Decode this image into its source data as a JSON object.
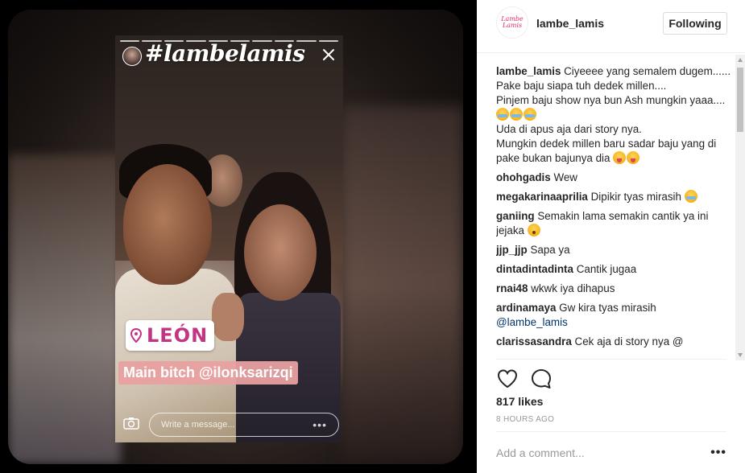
{
  "story": {
    "title": "#lambelamis",
    "location": "LEÓN",
    "mention": "Main bitch @ilonksarizqi",
    "message_placeholder": "Write a message...",
    "message_more": "•••"
  },
  "header": {
    "username": "lambe_lamis",
    "follow_label": "Following",
    "avatar_logo": "Lambe Lamis"
  },
  "caption": {
    "user": "lambe_lamis",
    "lines": [
      "Ciyeeee yang semalem dugem......",
      "Pake baju siapa tuh dedek millen....",
      "Pinjem baju show nya bun Ash mungkin yaaa....",
      "Uda di apus aja dari story nya.",
      "Mungkin dedek millen baru sadar baju yang di pake bukan bajunya dia"
    ]
  },
  "comments": [
    {
      "user": "ohohgadis",
      "text": "Wew"
    },
    {
      "user": "megakarinaaprilia",
      "text": "Dipikir tyas mirasih"
    },
    {
      "user": "ganiing",
      "text": "Semakin lama semakin cantik ya ini jejaka"
    },
    {
      "user": "jjp_jjp",
      "text": "Sapa ya"
    },
    {
      "user": "dintadintadinta",
      "text": "Cantik jugaa"
    },
    {
      "user": "rnai48",
      "text": "wkwk iya dihapus"
    },
    {
      "user": "ardinamaya",
      "text": "Gw kira tyas mirasih",
      "link": "@lambe_lamis"
    },
    {
      "user": "clarissasandra",
      "text": "Cek aja di story nya @"
    }
  ],
  "likes": "817 likes",
  "time_ago": "8 HOURS AGO",
  "add_comment_placeholder": "Add a comment...",
  "more_label": "•••",
  "icons": {
    "like": "heart-icon",
    "comment": "comment-bubble-icon",
    "close": "close-icon",
    "camera": "camera-icon",
    "location": "location-pin-icon"
  },
  "colors": {
    "link": "#003569",
    "location_text": "#c13584",
    "mention_bg": "#e8a0a0"
  }
}
